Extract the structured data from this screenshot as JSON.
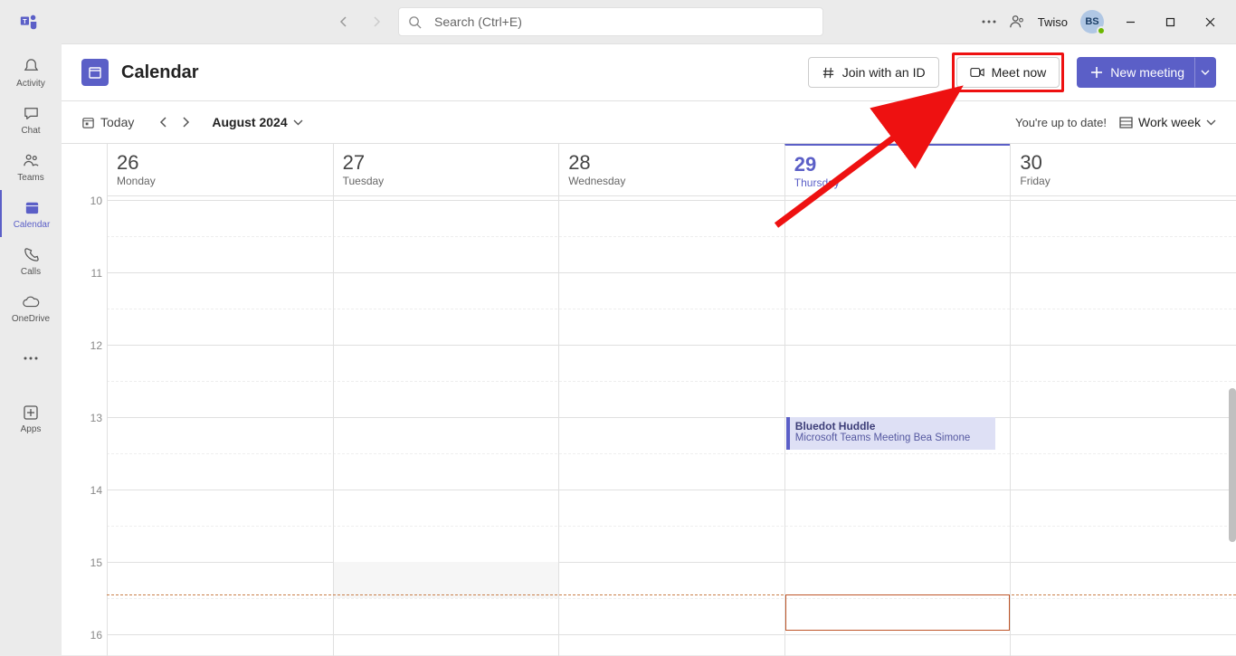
{
  "titlebar": {
    "search_placeholder": "Search (Ctrl+E)",
    "username": "Twiso",
    "avatar_initials": "BS"
  },
  "rail": {
    "items": [
      {
        "label": "Activity"
      },
      {
        "label": "Chat"
      },
      {
        "label": "Teams"
      },
      {
        "label": "Calendar"
      },
      {
        "label": "Calls"
      },
      {
        "label": "OneDrive"
      }
    ],
    "apps_label": "Apps"
  },
  "header": {
    "title": "Calendar",
    "join_label": "Join with an ID",
    "meet_label": "Meet now",
    "new_label": "New meeting"
  },
  "toolbar": {
    "today": "Today",
    "month": "August 2024",
    "status": "You're up to date!",
    "view": "Work week"
  },
  "days": [
    {
      "num": "26",
      "name": "Monday"
    },
    {
      "num": "27",
      "name": "Tuesday"
    },
    {
      "num": "28",
      "name": "Wednesday"
    },
    {
      "num": "29",
      "name": "Thursday"
    },
    {
      "num": "30",
      "name": "Friday"
    }
  ],
  "hours": [
    "10",
    "11",
    "12",
    "13",
    "14",
    "15",
    "16"
  ],
  "event": {
    "title": "Bluedot Huddle",
    "subtitle": "Microsoft Teams Meeting  Bea Simone"
  }
}
